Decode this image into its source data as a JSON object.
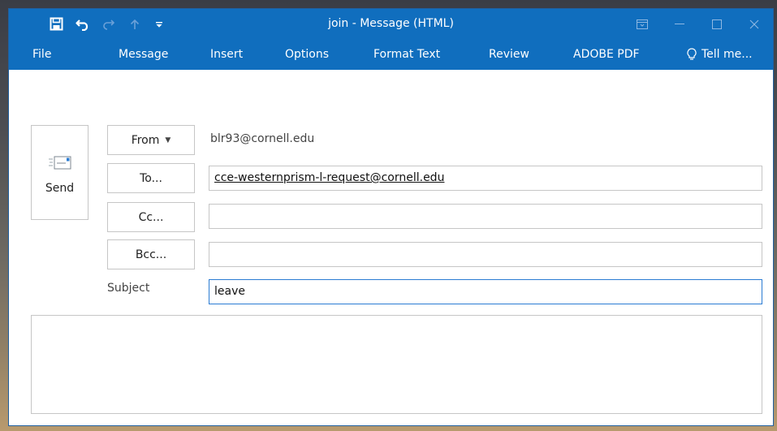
{
  "window": {
    "title": "join - Message (HTML)"
  },
  "quick_access": {
    "icons": [
      "save-icon",
      "undo-icon",
      "redo-icon",
      "up-arrow-icon",
      "customize-icon"
    ]
  },
  "menu": {
    "file": "File",
    "message": "Message",
    "insert": "Insert",
    "options": "Options",
    "format_text": "Format Text",
    "review": "Review",
    "adobe_pdf": "ADOBE PDF",
    "tell_me": "Tell me..."
  },
  "compose": {
    "send_label": "Send",
    "from_label": "From",
    "from_value": "blr93@cornell.edu",
    "to_label": "To...",
    "to_value": "cce-westernprism-l-request@cornell.edu",
    "cc_label": "Cc...",
    "cc_value": "",
    "bcc_label": "Bcc...",
    "bcc_value": "",
    "subject_label": "Subject",
    "subject_value": "leave",
    "body_value": ""
  },
  "colors": {
    "titlebar": "#106ebe",
    "focus_border": "#2b7cd3",
    "field_border": "#c6c6c6"
  }
}
